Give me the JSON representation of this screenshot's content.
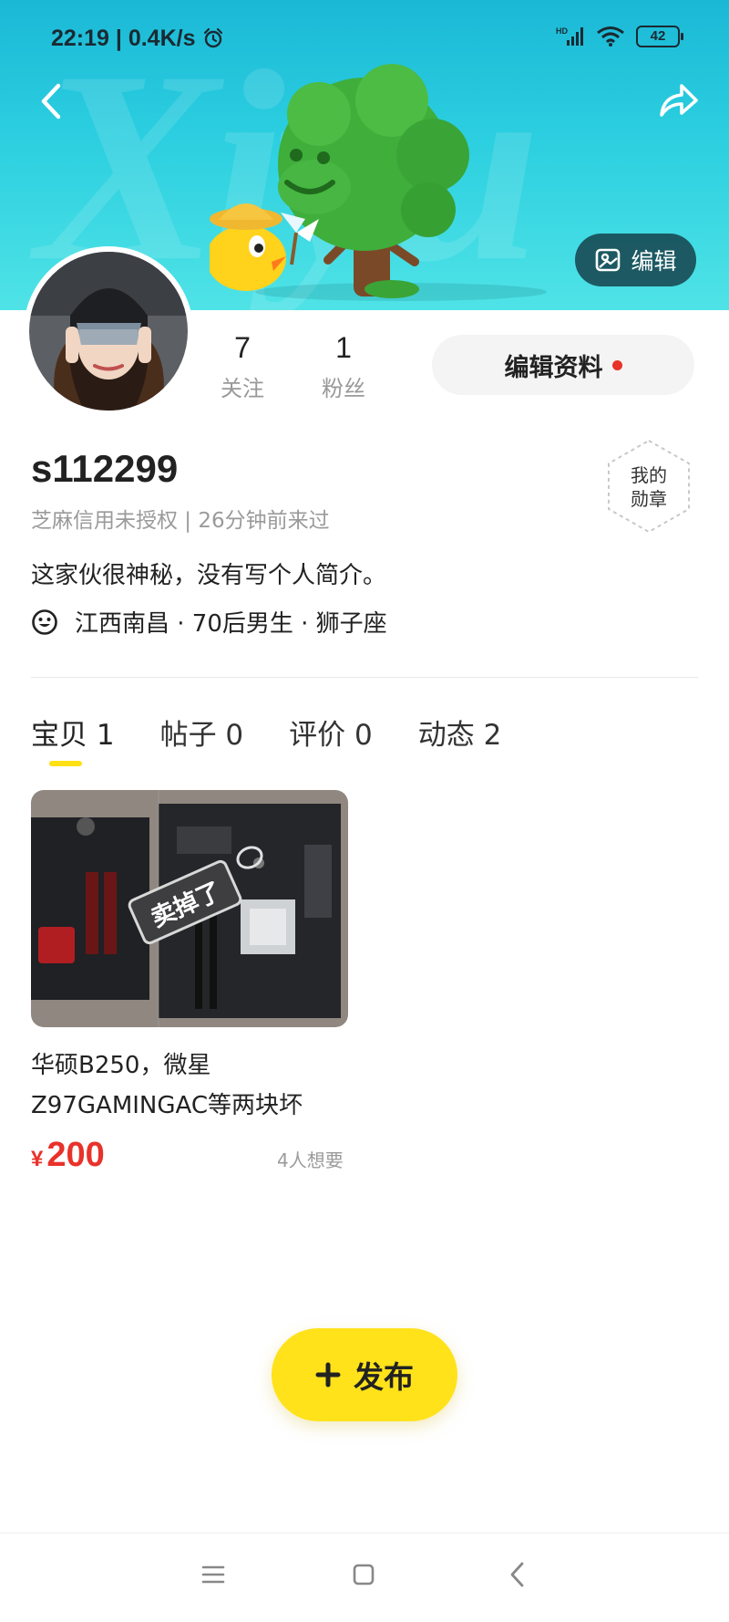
{
  "status_bar": {
    "time": "22:19 | 0.4K/s",
    "battery": "42"
  },
  "header": {
    "edit_cover_label": "编辑"
  },
  "profile": {
    "following_count": "7",
    "following_label": "关注",
    "followers_count": "1",
    "followers_label": "粉丝",
    "edit_profile_label": "编辑资料",
    "username": "s112299",
    "credit_line": "芝麻信用未授权 | 26分钟前来过",
    "medal_line1": "我的",
    "medal_line2": "勋章",
    "bio": "这家伙很神秘，没有写个人简介。",
    "info": "江西南昌 · 70后男生 · 狮子座"
  },
  "tabs": [
    {
      "label": "宝贝 1",
      "active": true
    },
    {
      "label": "帖子 0",
      "active": false
    },
    {
      "label": "评价 0",
      "active": false
    },
    {
      "label": "动态 2",
      "active": false
    }
  ],
  "items": [
    {
      "sold_tag": "卖掉了",
      "title": "华硕B250，微星Z97GAMINGAC等两块坏",
      "currency": "¥",
      "price": "200",
      "wants": "4人想要"
    }
  ],
  "publish_label": "发布",
  "colors": {
    "accent_yellow": "#ffe21a",
    "price_red": "#e8322a",
    "banner_teal": "#2ccfe0"
  },
  "icons": [
    "back-icon",
    "share-icon",
    "image-icon",
    "smile-icon",
    "plus-icon",
    "menu-icon",
    "home-square-icon",
    "nav-back-icon"
  ]
}
